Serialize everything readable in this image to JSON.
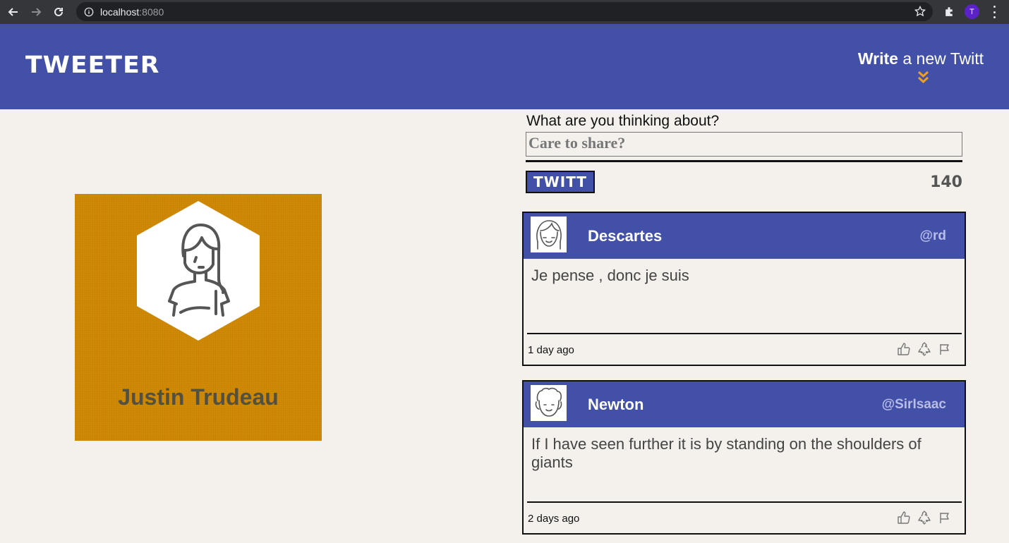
{
  "browser": {
    "url_host": "localhost",
    "url_port": ":8080",
    "profile_initial": "T"
  },
  "header": {
    "logo": "TWEETER",
    "write_bold": "Write",
    "write_rest": " a new Twitt"
  },
  "profile": {
    "name": "Justin Trudeau"
  },
  "composer": {
    "label": "What are you thinking about?",
    "placeholder": "Care to share?",
    "button_label": "TWITT",
    "counter": "140"
  },
  "tweets": [
    {
      "name": "Descartes",
      "handle": "@rd",
      "text": "Je pense , donc je suis",
      "time": "1 day ago"
    },
    {
      "name": "Newton",
      "handle": "@SirIsaac",
      "text": "If I have seen further it is by standing on the shoulders of giants",
      "time": "2 days ago"
    }
  ],
  "icons": {
    "like": "thumbs-up-icon",
    "retweet": "recycle-icon",
    "flag": "flag-icon"
  },
  "colors": {
    "brand": "#4250a8",
    "profile_card": "#d18a06",
    "accent": "#f0a020",
    "background": "#f4f1ec"
  }
}
